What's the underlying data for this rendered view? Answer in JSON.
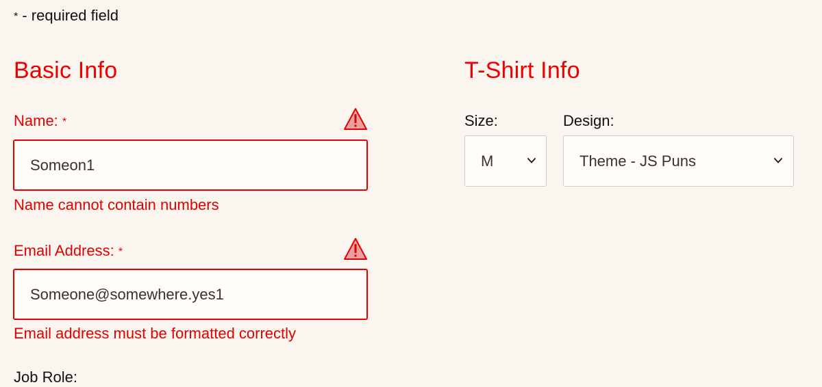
{
  "form": {
    "required_note": {
      "asterisk": "*",
      "text": " - required field"
    },
    "basic_info": {
      "title": "Basic Info",
      "name": {
        "label": "Name:",
        "required_mark": "*",
        "value": "Someon1",
        "error": "Name cannot contain numbers"
      },
      "email": {
        "label": "Email Address:",
        "required_mark": "*",
        "value": "Someone@somewhere.yes1",
        "error": "Email address must be formatted correctly"
      },
      "job_role": {
        "label": "Job Role:"
      }
    },
    "tshirt_info": {
      "title": "T-Shirt Info",
      "size": {
        "label": "Size:",
        "selected": "M"
      },
      "design": {
        "label": "Design:",
        "selected": "Theme - JS Puns"
      }
    }
  },
  "icons": {
    "warning": "warning-triangle-icon",
    "chevron": "chevron-down-icon"
  },
  "colors": {
    "background": "#faf5ef",
    "error": "#e30000",
    "heading": "#ee0000",
    "warning_fill": "#e9a0a0"
  }
}
